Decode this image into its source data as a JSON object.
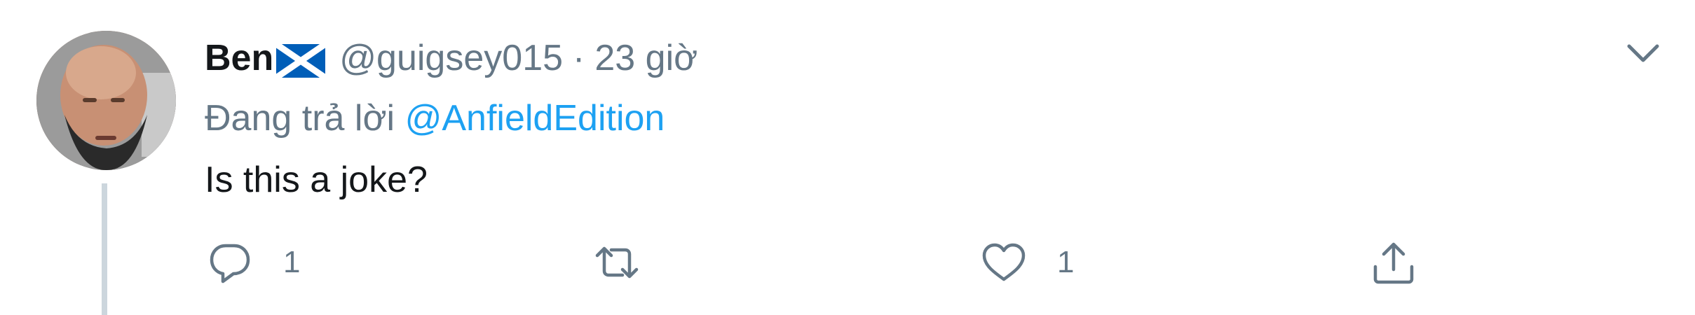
{
  "tweet": {
    "display_name": "Ben",
    "handle": "@guigsey015",
    "separator": "·",
    "time": "23 giờ",
    "replying_prefix": "Đang trả lời",
    "replying_to": "@AnfieldEdition",
    "text": "Is this a joke?",
    "actions": {
      "reply_count": "1",
      "retweet_count": "",
      "like_count": "1"
    }
  },
  "colors": {
    "text_primary": "#14171a",
    "text_secondary": "#657786",
    "link": "#1da1f2",
    "thread_line": "#ccd6dd",
    "flag_blue": "#005eb8",
    "flag_white": "#ffffff"
  },
  "icons": {
    "flag": "scotland-flag-icon",
    "more": "chevron-down-icon",
    "reply": "reply-bubble-icon",
    "retweet": "retweet-icon",
    "like": "heart-icon",
    "share": "share-upload-icon"
  }
}
